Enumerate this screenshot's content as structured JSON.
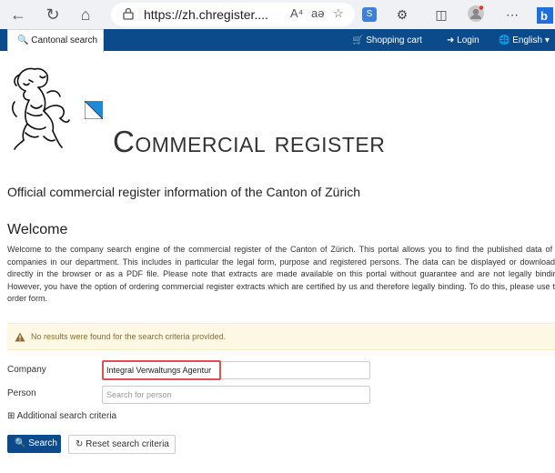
{
  "browser": {
    "url": "https://zh.chregister....",
    "read_aloud": "A⁴",
    "translate": "aə"
  },
  "site_nav": {
    "tab_label": "Cantonal search",
    "shopping_cart": "Shopping cart",
    "login": "Login",
    "language": "English"
  },
  "header": {
    "title": "Commercial register",
    "subtitle": "Official commercial register information of the Canton of Zürich"
  },
  "welcome": {
    "heading": "Welcome",
    "text": "Welcome to the company search engine of the commercial register of the Canton of Zürich. This portal allows you to find the published data of all companies in our department. This includes in particular the legal form, purpose and registered persons. The data can be displayed or downloaded directly in the browser or as a PDF file. Please note that extracts are made available on this portal without guarantee and are not legally binding. However, you have the option of ordering commercial register extracts which are certified by us and therefore legally binding. To do this, please use the order form."
  },
  "alert": {
    "text": "No results were found for the search criteria provided."
  },
  "form": {
    "company_label": "Company",
    "company_value": "Integral Verwaltungs Agentur",
    "person_label": "Person",
    "person_placeholder": "Search for person",
    "additional_label": "⊞ Additional search criteria",
    "search_button": "Search",
    "reset_button": "Reset search criteria"
  },
  "colors": {
    "nav_blue": "#0b4a8b",
    "alert_bg": "#fcf8e3",
    "alert_text": "#8a6d3b",
    "highlight": "#d9534f"
  }
}
